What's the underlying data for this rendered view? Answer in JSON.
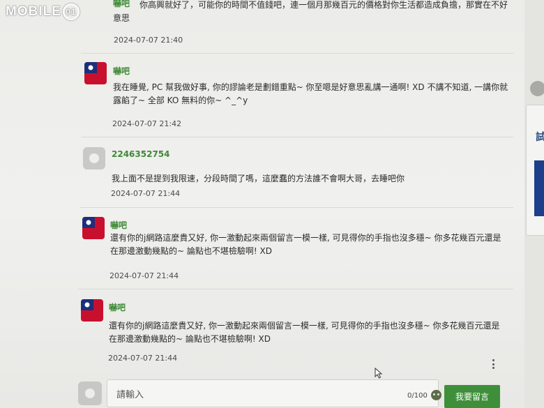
{
  "logo": {
    "text": "MOBILE",
    "circle": "01"
  },
  "colors": {
    "author": "#3f8a36",
    "button": "#3f8f3a",
    "flag_red": "#c8102e",
    "flag_blue": "#1d2f7a"
  },
  "comments": [
    {
      "author": "嚇吧",
      "body": "你高興就好了，可能你的時間不值錢吧，連一個月那幾百元的價格對你生活都造成負擔，那實在不好意思",
      "time": "2024-07-07 21:40",
      "avatar": "flag-icon"
    },
    {
      "author": "嚇吧",
      "body": "我在睡覺, PC 幫我做好事, 你的謬論老是劃錯重點~ 你至嗯是好意思亂講一通啊! XD 不講不知道, 一講你就露餡了~ 全部 KO 無料的你~ ^_^y",
      "time": "2024-07-07 21:42",
      "avatar": "flag-icon"
    },
    {
      "author": "2246352754",
      "body": "我上面不是提到我限速，分段時間了嗎，這麼蠢的方法誰不會啊大哥，去睡吧你",
      "time": "2024-07-07 21:44",
      "avatar": "default-avatar-icon"
    },
    {
      "author": "嚇吧",
      "body": "還有你的j網路這麼貴又好, 你一激動起來兩個留言一模一樣, 可見得你的手指也沒多穩~ 你多花幾百元還是在那邊激動幾點的~ 論點也不堪檢驗啊! XD",
      "time": "2024-07-07 21:44",
      "avatar": "flag-icon"
    },
    {
      "author": "嚇吧",
      "body": "還有你的j網路這麼貴又好, 你一激動起來兩個留言一模一樣, 可見得你的手指也沒多穩~ 你多花幾百元還是在那邊激動幾點的~ 論點也不堪檢驗啊! XD",
      "time": "2024-07-07 21:44",
      "avatar": "flag-icon"
    }
  ],
  "composer": {
    "placeholder": "請輸入",
    "char_count": "0/100",
    "submit_label": "我要留言"
  }
}
